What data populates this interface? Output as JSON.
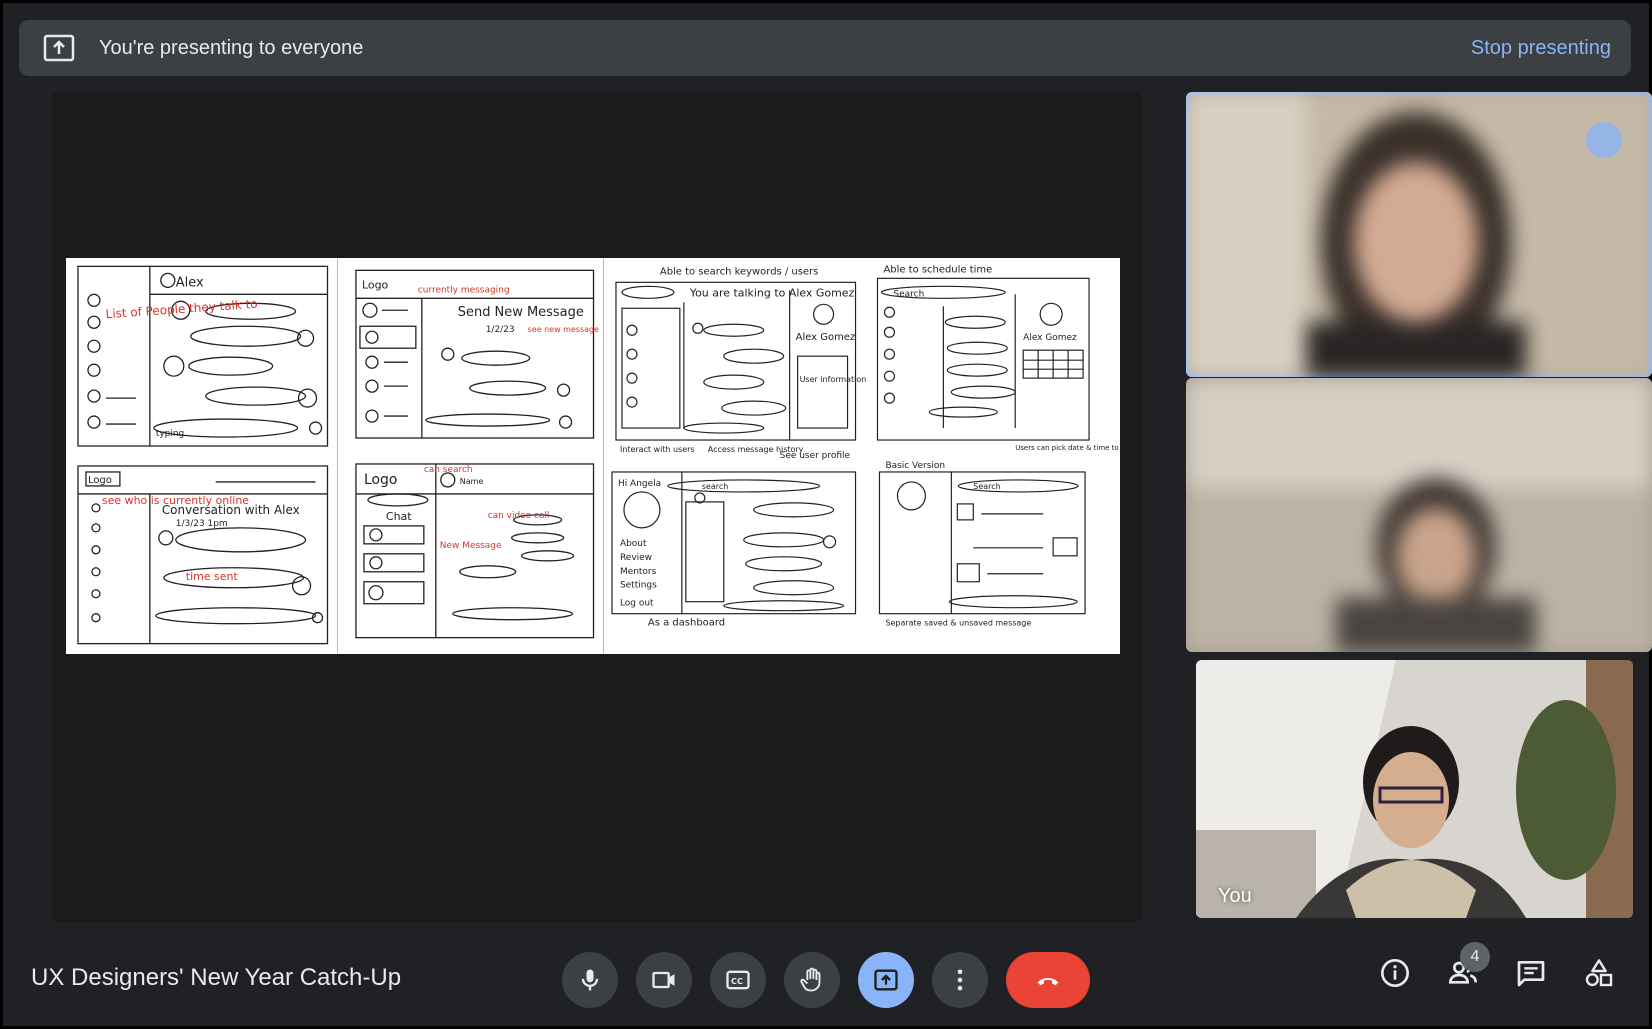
{
  "banner": {
    "text": "You're presenting to everyone",
    "stop_label": "Stop presenting"
  },
  "sketch": {
    "panel1_top_name": "Alex",
    "panel1_top_note": "List of People they talk to",
    "panel1_bottom_logo": "Logo",
    "panel1_bottom_note": "see who is currently online",
    "panel1_bottom_title": "Conversation with Alex",
    "panel1_bottom_time": "1/3/23 1pm",
    "panel1_bottom_sent": "time sent",
    "panel1_top_input": "typing",
    "panel2_top_logo": "Logo",
    "panel2_top_note": "currently messaging",
    "panel2_top_title": "Send New Message",
    "panel2_top_date": "1/2/23",
    "panel2_top_note2": "see new message",
    "panel2_bottom_logo": "Logo",
    "panel2_bottom_search": "can search",
    "panel2_bottom_chat": "Chat",
    "panel2_bottom_name": "Name",
    "panel2_bottom_video": "can video call",
    "panel2_bottom_new": "New Message",
    "panel3_a_note": "Able to search keywords / users",
    "panel3_a_title": "You are talking to Alex Gomez",
    "panel3_a_name": "Alex Gomez",
    "panel3_a_info": "User information",
    "panel3_a_foot1": "Interact with users",
    "panel3_a_foot2": "Access message history",
    "panel3_a_foot3": "See user profile",
    "panel3_b_note": "Able to schedule time",
    "panel3_b_search": "Search",
    "panel3_b_name": "Alex Gomez",
    "panel3_b_foot": "Users can pick date & time to meet",
    "panel3_c_hi": "Hi Angela",
    "panel3_c_search": "search",
    "panel3_c_menu": [
      "About",
      "Review",
      "Mentors",
      "Settings",
      "Log out"
    ],
    "panel3_c_foot": "As a dashboard",
    "panel3_d_title": "Basic Version",
    "panel3_d_search": "Search",
    "panel3_d_foot": "Separate saved & unsaved message"
  },
  "participants": {
    "self_label": "You"
  },
  "meeting": {
    "title": "UX Designers' New Year Catch-Up",
    "participant_count": "4"
  },
  "icons": {
    "present": "present-to-all-icon",
    "mic": "mic-icon",
    "camera": "videocam-icon",
    "captions": "closed-caption-icon",
    "hand": "raise-hand-icon",
    "present_btn": "present-to-all-icon",
    "more": "more-vert-icon",
    "end": "call-end-icon",
    "info": "info-icon",
    "people": "people-icon",
    "chat": "chat-icon",
    "activities": "activities-icon"
  },
  "colors": {
    "accent": "#8ab4f8",
    "end_call": "#ea4335",
    "sketch_red": "#d9342b"
  }
}
